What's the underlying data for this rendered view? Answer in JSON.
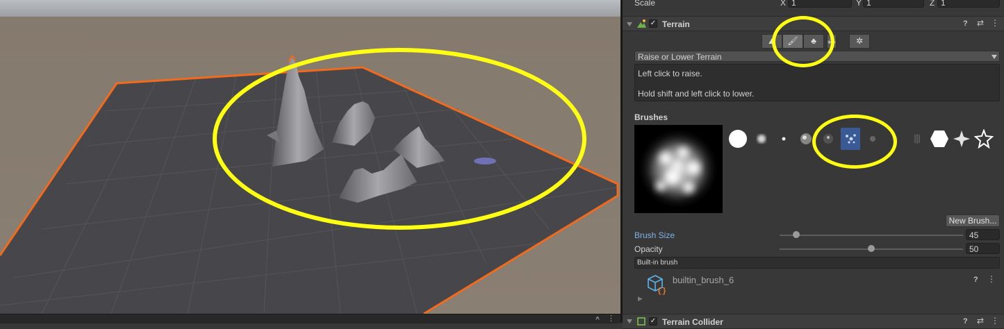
{
  "transform": {
    "scale_label": "Scale",
    "x_label": "X",
    "x_value": "1",
    "y_label": "Y",
    "y_value": "1",
    "z_label": "Z",
    "z_value": "1"
  },
  "terrain": {
    "title": "Terrain",
    "enabled_mark": "✓",
    "mode_dropdown": "Raise or Lower Terrain",
    "help_line1": "Left click to raise.",
    "help_line2": "Hold shift and left click to lower.",
    "brushes_label": "Brushes",
    "new_brush_button": "New Brush...",
    "brush_size_label": "Brush Size",
    "brush_size_value": "45",
    "brush_size_fraction": 0.09,
    "opacity_label": "Opacity",
    "opacity_value": "50",
    "opacity_fraction": 0.5,
    "builtin_label": "Built-in brush",
    "brush_asset_name": "builtin_brush_6",
    "tool_icons": [
      "raise-lower-icon",
      "paint-brush-icon",
      "paint-trees-icon",
      "paint-details-icon",
      "settings-gear-icon"
    ],
    "selected_tool": 1,
    "selected_brush": 5
  },
  "collider": {
    "title": "Terrain Collider",
    "enabled_mark": "✓"
  },
  "colors": {
    "accent_highlight": "#ffff13",
    "selection_outline": "#f26b1d",
    "label_blue": "#7eb4ea",
    "selected_brush_bg": "#3a5a96"
  }
}
